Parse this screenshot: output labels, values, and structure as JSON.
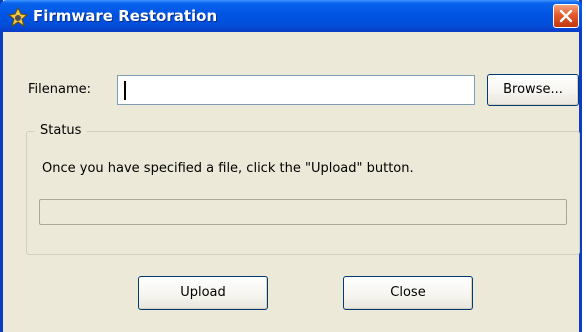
{
  "window": {
    "title": "Firmware Restoration",
    "icons": {
      "app": "firmware-restore-icon",
      "close": "close-icon"
    }
  },
  "file": {
    "label": "Filename:",
    "value": "",
    "browse_label": "Browse..."
  },
  "status": {
    "legend": "Status",
    "message": "Once you have specified a file, click the \"Upload\" button.",
    "progress": 0
  },
  "actions": {
    "upload_label": "Upload",
    "close_label": "Close"
  },
  "colors": {
    "titlebar": "#0054e3",
    "close_button": "#e35a2b",
    "dialog_background": "#ece9d8",
    "input_border": "#7f9db9"
  }
}
